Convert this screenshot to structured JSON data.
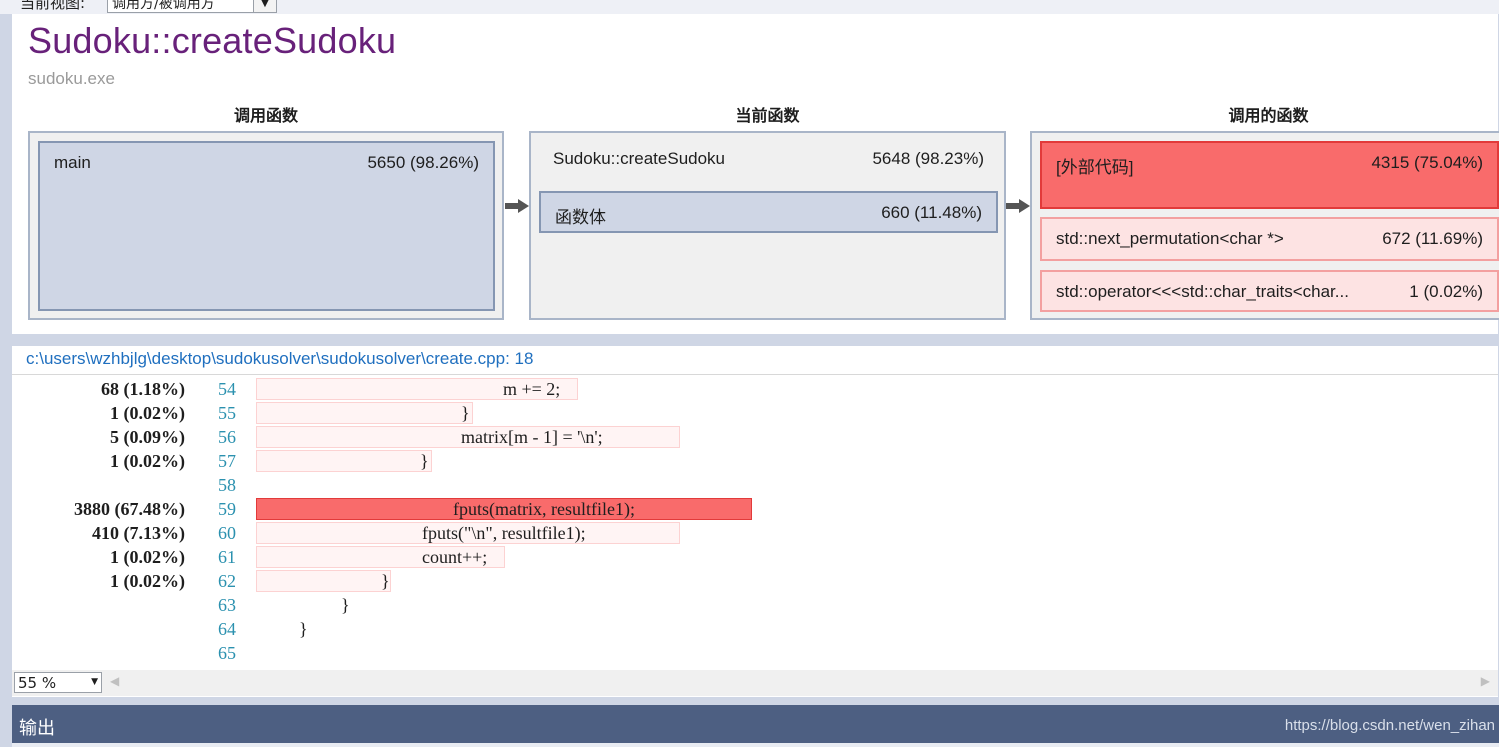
{
  "view_selector": {
    "label": "当前视图:",
    "value": "调用方/被调用方"
  },
  "function_title": "Sudoku::createSudoku",
  "module": "sudoku.exe",
  "columns": {
    "callers_header": "调用函数",
    "current_header": "当前函数",
    "callees_header": "调用的函数"
  },
  "callers": [
    {
      "name": "main",
      "value": "5650 (98.26%)"
    }
  ],
  "current": {
    "name": "Sudoku::createSudoku",
    "value": "5648 (98.23%)",
    "body_name": "函数体",
    "body_value": "660 (11.48%)"
  },
  "callees": [
    {
      "name": "[外部代码]",
      "value": "4315 (75.04%)",
      "heat": "hot"
    },
    {
      "name": "std::next_permutation<char *>",
      "value": "672 (11.69%)",
      "heat": "warm"
    },
    {
      "name": "std::operator<<<std::char_traits<char...",
      "value": "1 (0.02%)",
      "heat": "warm"
    }
  ],
  "source_path": "c:\\users\\wzhbjlg\\desktop\\sudokusolver\\sudokusolver\\create.cpp: 18",
  "code_lines": [
    {
      "count": "68 (1.18%)",
      "line": "54",
      "code": "m += 2;",
      "heat": "hl"
    },
    {
      "count": "1 (0.02%)",
      "line": "55",
      "code": "}",
      "heat": "hl"
    },
    {
      "count": "5 (0.09%)",
      "line": "56",
      "code": "matrix[m - 1] = '\\n';",
      "heat": "hl"
    },
    {
      "count": "1 (0.02%)",
      "line": "57",
      "code": "}",
      "heat": "hl"
    },
    {
      "count": "",
      "line": "58",
      "code": "",
      "heat": "none"
    },
    {
      "count": "3880 (67.48%)",
      "line": "59",
      "code": "fputs(matrix, resultfile1);",
      "heat": "hot"
    },
    {
      "count": "410 (7.13%)",
      "line": "60",
      "code": "fputs(\"\\n\", resultfile1);",
      "heat": "hl"
    },
    {
      "count": "1 (0.02%)",
      "line": "61",
      "code": "count++;",
      "heat": "hl"
    },
    {
      "count": "1 (0.02%)",
      "line": "62",
      "code": "}",
      "heat": "hl"
    },
    {
      "count": "",
      "line": "63",
      "code": "}",
      "heat": "none"
    },
    {
      "count": "",
      "line": "64",
      "code": "}",
      "heat": "none"
    },
    {
      "count": "",
      "line": "65",
      "code": "",
      "heat": "none"
    }
  ],
  "zoom": "55 %",
  "output_panel": {
    "title": "输出",
    "watermark": "https://blog.csdn.net/wen_zihan"
  }
}
